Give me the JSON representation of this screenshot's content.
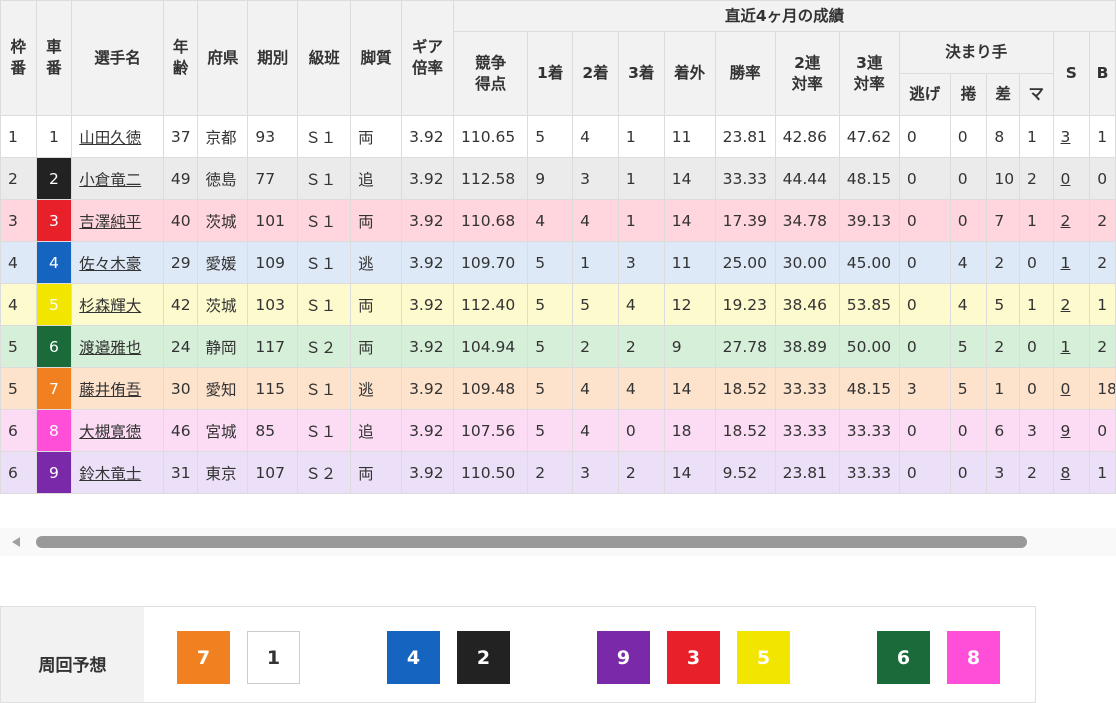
{
  "header": {
    "waku": [
      "枠",
      "番"
    ],
    "sha": [
      "車",
      "番"
    ],
    "name": "選手名",
    "age": [
      "年",
      "齢"
    ],
    "pref": "府県",
    "term": "期別",
    "class": "級班",
    "leg": "脚質",
    "gear": [
      "ギア",
      "倍率"
    ],
    "recent": "直近4ヶ月の成績",
    "score": [
      "競争",
      "得点"
    ],
    "p1": "1着",
    "p2": "2着",
    "p3": "3着",
    "out": "着外",
    "win": "勝率",
    "ren2": [
      "2連",
      "対率"
    ],
    "ren3": [
      "3連",
      "対率"
    ],
    "kimarite": "決まり手",
    "nige": "逃げ",
    "makuri": "捲",
    "sashi": "差",
    "mark": "マ",
    "s": "S",
    "b": "B"
  },
  "car_colors": {
    "1": {
      "bg": "#ffffff",
      "fg": "#333333"
    },
    "2": {
      "bg": "#222222",
      "fg": "#ffffff"
    },
    "3": {
      "bg": "#e8202a",
      "fg": "#ffffff"
    },
    "4": {
      "bg": "#1565c0",
      "fg": "#ffffff"
    },
    "5": {
      "bg": "#f2e500",
      "fg": "#ffffff"
    },
    "6": {
      "bg": "#1b6b3a",
      "fg": "#ffffff"
    },
    "7": {
      "bg": "#f08020",
      "fg": "#ffffff"
    },
    "8": {
      "bg": "#ff4fd8",
      "fg": "#ffffff"
    },
    "9": {
      "bg": "#7a2aa8",
      "fg": "#ffffff"
    }
  },
  "rows": [
    {
      "waku": "1",
      "car": "1",
      "name": "山田久徳",
      "age": "37",
      "pref": "京都",
      "term": "93",
      "cls": "Ｓ１",
      "leg": "両",
      "gear": "3.92",
      "score": "110.65",
      "p1": "5",
      "p2": "4",
      "p3": "1",
      "out": "11",
      "win": "23.81",
      "r2": "42.86",
      "r3": "47.62",
      "nige": "0",
      "makuri": "0",
      "sashi": "8",
      "mark": "1",
      "s": "3",
      "b": "1",
      "bg": "#ffffff"
    },
    {
      "waku": "2",
      "car": "2",
      "name": "小倉竜二",
      "age": "49",
      "pref": "徳島",
      "term": "77",
      "cls": "Ｓ１",
      "leg": "追",
      "gear": "3.92",
      "score": "112.58",
      "p1": "9",
      "p2": "3",
      "p3": "1",
      "out": "14",
      "win": "33.33",
      "r2": "44.44",
      "r3": "48.15",
      "nige": "0",
      "makuri": "0",
      "sashi": "10",
      "mark": "2",
      "s": "0",
      "b": "0",
      "bg": "#ebebeb"
    },
    {
      "waku": "3",
      "car": "3",
      "name": "吉澤純平",
      "age": "40",
      "pref": "茨城",
      "term": "101",
      "cls": "Ｓ１",
      "leg": "両",
      "gear": "3.92",
      "score": "110.68",
      "p1": "4",
      "p2": "4",
      "p3": "1",
      "out": "14",
      "win": "17.39",
      "r2": "34.78",
      "r3": "39.13",
      "nige": "0",
      "makuri": "0",
      "sashi": "7",
      "mark": "1",
      "s": "2",
      "b": "2",
      "bg": "#ffd6de"
    },
    {
      "waku": "4",
      "car": "4",
      "name": "佐々木豪",
      "age": "29",
      "pref": "愛媛",
      "term": "109",
      "cls": "Ｓ１",
      "leg": "逃",
      "gear": "3.92",
      "score": "109.70",
      "p1": "5",
      "p2": "1",
      "p3": "3",
      "out": "11",
      "win": "25.00",
      "r2": "30.00",
      "r3": "45.00",
      "nige": "0",
      "makuri": "4",
      "sashi": "2",
      "mark": "0",
      "s": "1",
      "b": "2",
      "bg": "#dde9f7"
    },
    {
      "waku": "4",
      "car": "5",
      "name": "杉森輝大",
      "age": "42",
      "pref": "茨城",
      "term": "103",
      "cls": "Ｓ１",
      "leg": "両",
      "gear": "3.92",
      "score": "112.40",
      "p1": "5",
      "p2": "5",
      "p3": "4",
      "out": "12",
      "win": "19.23",
      "r2": "38.46",
      "r3": "53.85",
      "nige": "0",
      "makuri": "4",
      "sashi": "5",
      "mark": "1",
      "s": "2",
      "b": "1",
      "bg": "#fdfacd"
    },
    {
      "waku": "5",
      "car": "6",
      "name": "渡邉雅也",
      "age": "24",
      "pref": "静岡",
      "term": "117",
      "cls": "Ｓ２",
      "leg": "両",
      "gear": "3.92",
      "score": "104.94",
      "p1": "5",
      "p2": "2",
      "p3": "2",
      "out": "9",
      "win": "27.78",
      "r2": "38.89",
      "r3": "50.00",
      "nige": "0",
      "makuri": "5",
      "sashi": "2",
      "mark": "0",
      "s": "1",
      "b": "2",
      "bg": "#d5efd8"
    },
    {
      "waku": "5",
      "car": "7",
      "name": "藤井侑吾",
      "age": "30",
      "pref": "愛知",
      "term": "115",
      "cls": "Ｓ１",
      "leg": "逃",
      "gear": "3.92",
      "score": "109.48",
      "p1": "5",
      "p2": "4",
      "p3": "4",
      "out": "14",
      "win": "18.52",
      "r2": "33.33",
      "r3": "48.15",
      "nige": "3",
      "makuri": "5",
      "sashi": "1",
      "mark": "0",
      "s": "0",
      "b": "18",
      "bg": "#fde2cc"
    },
    {
      "waku": "6",
      "car": "8",
      "name": "大槻寛徳",
      "age": "46",
      "pref": "宮城",
      "term": "85",
      "cls": "Ｓ１",
      "leg": "追",
      "gear": "3.92",
      "score": "107.56",
      "p1": "5",
      "p2": "4",
      "p3": "0",
      "out": "18",
      "win": "18.52",
      "r2": "33.33",
      "r3": "33.33",
      "nige": "0",
      "makuri": "0",
      "sashi": "6",
      "mark": "3",
      "s": "9",
      "b": "0",
      "bg": "#fbdcf4"
    },
    {
      "waku": "6",
      "car": "9",
      "name": "鈴木竜士",
      "age": "31",
      "pref": "東京",
      "term": "107",
      "cls": "Ｓ２",
      "leg": "両",
      "gear": "3.92",
      "score": "110.50",
      "p1": "2",
      "p2": "3",
      "p3": "2",
      "out": "14",
      "win": "9.52",
      "r2": "23.81",
      "r3": "33.33",
      "nige": "0",
      "makuri": "0",
      "sashi": "3",
      "mark": "2",
      "s": "8",
      "b": "1",
      "bg": "#ebe0f7"
    }
  ],
  "scrollbar": {
    "left_arrow_icon": "triangle-left-icon"
  },
  "forecast": {
    "label": "周回予想",
    "chips": [
      "7",
      "1",
      "4",
      "2",
      "9",
      "3",
      "5",
      "6",
      "8"
    ]
  }
}
